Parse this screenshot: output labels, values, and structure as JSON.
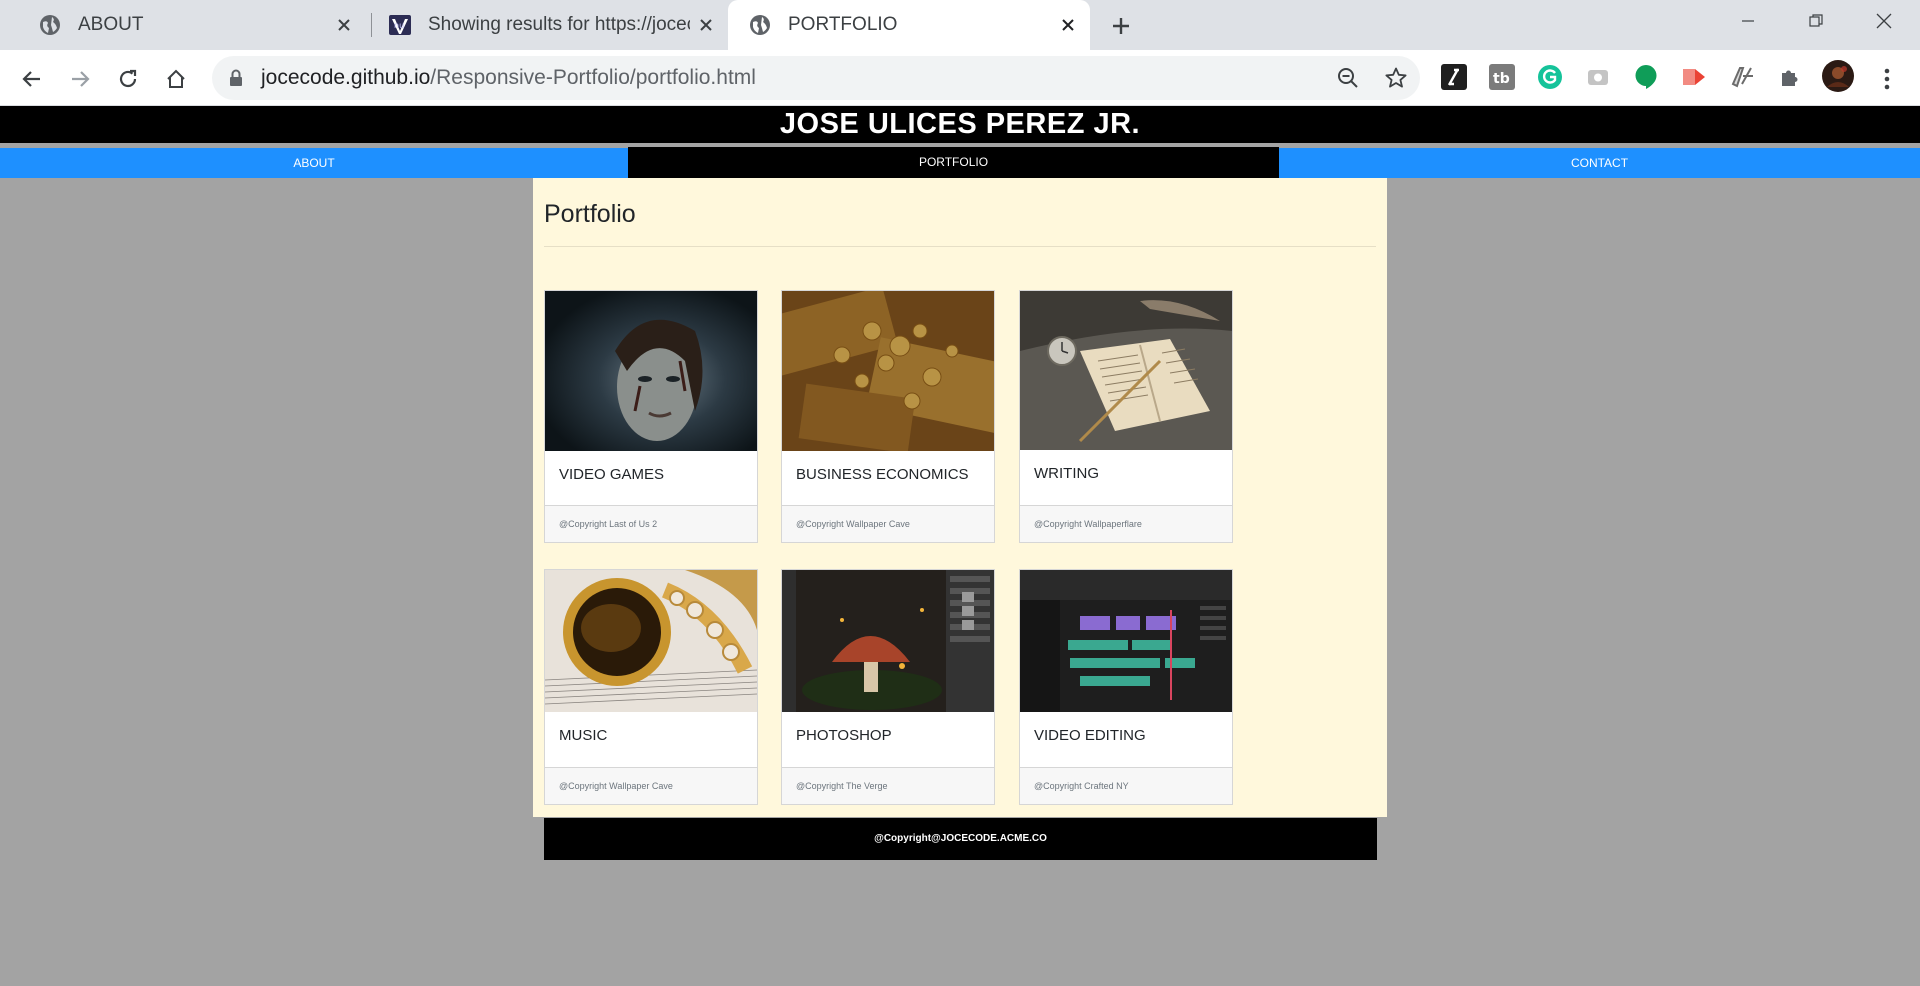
{
  "browser": {
    "tabs": [
      {
        "title": "ABOUT",
        "icon": "globe-icon",
        "active": false
      },
      {
        "title": "Showing results for https://jocec",
        "icon": "nu-html-checker-icon",
        "active": false
      },
      {
        "title": "PORTFOLIO",
        "icon": "globe-icon",
        "active": true
      }
    ],
    "address": {
      "host": "jocecode.github.io",
      "path": "/Responsive-Portfolio/portfolio.html"
    },
    "extension_icons": [
      "slash-ext-icon",
      "tb-ext-icon",
      "grammarly-icon",
      "camera-ext-icon",
      "hangouts-icon",
      "record-ext-icon",
      "translate-ext-icon",
      "puzzle-icon",
      "profile-avatar"
    ],
    "accent": "#1e90ff"
  },
  "site": {
    "header_title": "JOSE ULICES PEREZ JR.",
    "nav": {
      "items": [
        "ABOUT",
        "PORTFOLIO",
        "CONTACT"
      ],
      "active": "PORTFOLIO"
    },
    "page_title": "Portfolio",
    "cards": [
      {
        "title": "VIDEO GAMES",
        "credit": "@Copyright Last of Us 2",
        "image": "game-character-photo"
      },
      {
        "title": "BUSINESS ECONOMICS",
        "credit": "@Copyright Wallpaper Cave",
        "image": "coins-and-bills-photo"
      },
      {
        "title": "WRITING",
        "credit": "@Copyright Wallpaperflare",
        "image": "open-book-quill-photo"
      },
      {
        "title": "MUSIC",
        "credit": "@Copyright Wallpaper Cave",
        "image": "saxophone-photo"
      },
      {
        "title": "PHOTOSHOP",
        "credit": "@Copyright The Verge",
        "image": "photoshop-mushroom-photo"
      },
      {
        "title": "VIDEO EDITING",
        "credit": "@Copyright Crafted NY",
        "image": "video-editor-timeline-photo"
      }
    ],
    "footer": "@Copyright@JOCECODE.ACME.CO",
    "colors": {
      "header_bg": "#000000",
      "nav_bg": "#1e90ff",
      "content_bg": "#fff8dc",
      "page_bg": "#a3a3a3"
    }
  }
}
